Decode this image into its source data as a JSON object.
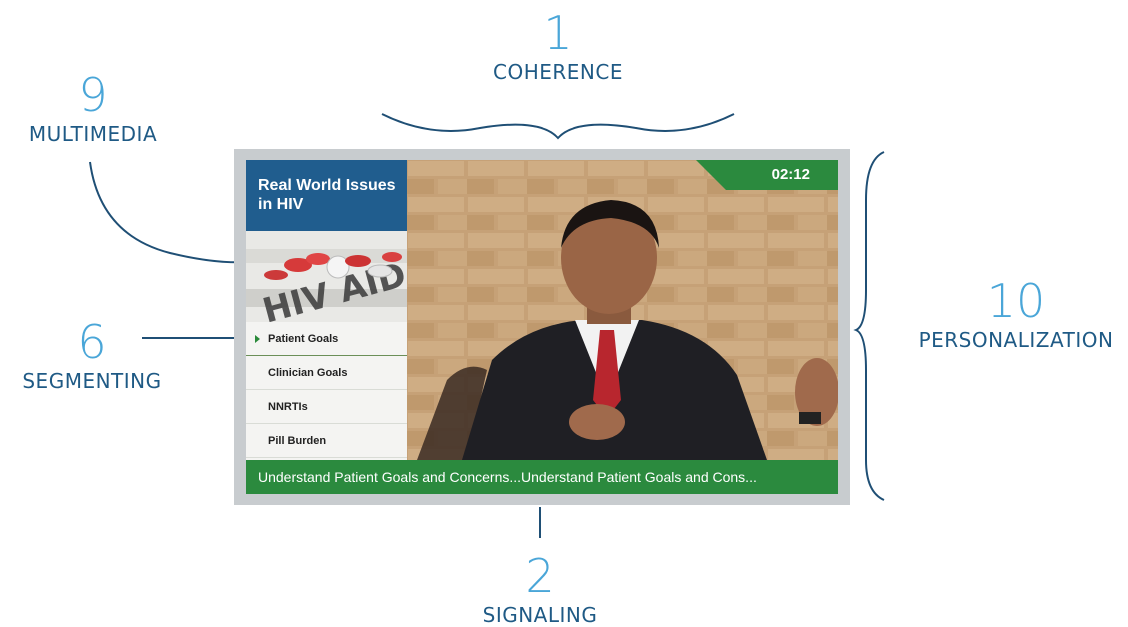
{
  "annotations": {
    "coherence": {
      "number": "1",
      "label": "COHERENCE"
    },
    "signaling": {
      "number": "2",
      "label": "SIGNALING"
    },
    "segmenting": {
      "number": "6",
      "label": "SEGMENTING"
    },
    "multimedia": {
      "number": "9",
      "label": "MULTIMEDIA"
    },
    "personalization": {
      "number": "10",
      "label": "PERSONALIZATION"
    }
  },
  "player": {
    "course_title": "Real World Issues in HIV",
    "thumbnail_text": "HIV AID",
    "timer": "02:12",
    "menu": [
      {
        "label": "Patient Goals",
        "active": true
      },
      {
        "label": "Clinician Goals",
        "active": false
      },
      {
        "label": "NNRTIs",
        "active": false
      },
      {
        "label": "Pill Burden",
        "active": false
      }
    ],
    "ticker": "Understand Patient Goals and Concerns...Understand Patient Goals and Cons..."
  },
  "colors": {
    "accent_green": "#2b8a3e",
    "title_blue": "#205d8e",
    "annotation_number": "#4aa6d8",
    "annotation_label": "#1f5a85",
    "bracket_line": "#1f4f75"
  },
  "icons": [
    "play-arrow-icon"
  ]
}
